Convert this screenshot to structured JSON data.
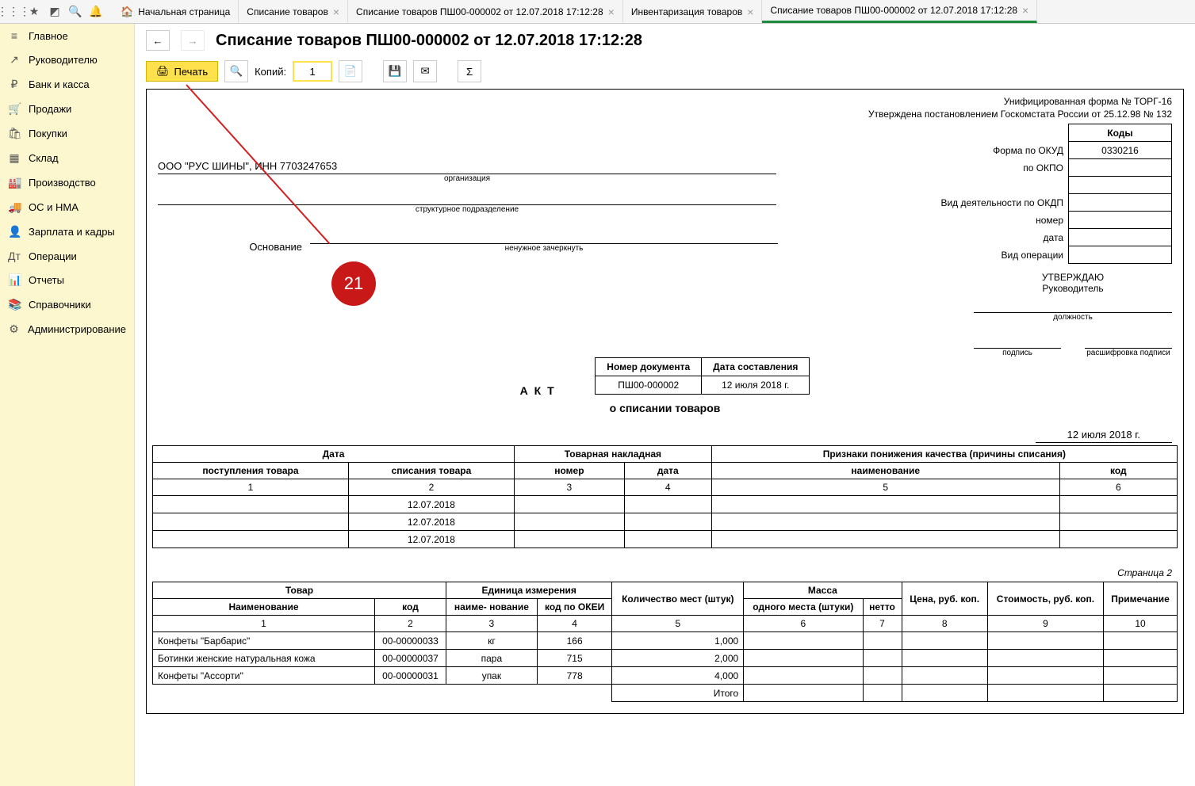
{
  "toolbar": {
    "icons": [
      "apps",
      "star",
      "crop",
      "search",
      "bell"
    ]
  },
  "tabs": [
    {
      "label": "Начальная страница",
      "home": true
    },
    {
      "label": "Списание товаров",
      "close": true
    },
    {
      "label": "Списание товаров ПШ00-000002 от 12.07.2018 17:12:28",
      "close": true
    },
    {
      "label": "Инвентаризация товаров",
      "close": true
    },
    {
      "label": "Списание товаров ПШ00-000002 от 12.07.2018 17:12:28",
      "close": true,
      "active": true
    }
  ],
  "sidebar": [
    {
      "icon": "≡",
      "label": "Главное"
    },
    {
      "icon": "↗",
      "label": "Руководителю"
    },
    {
      "icon": "₽",
      "label": "Банк и касса"
    },
    {
      "icon": "🛒",
      "label": "Продажи"
    },
    {
      "icon": "🛍",
      "label": "Покупки"
    },
    {
      "icon": "▦",
      "label": "Склад"
    },
    {
      "icon": "🏭",
      "label": "Производство"
    },
    {
      "icon": "🚚",
      "label": "ОС и НМА"
    },
    {
      "icon": "👤",
      "label": "Зарплата и кадры"
    },
    {
      "icon": "Дт",
      "label": "Операции"
    },
    {
      "icon": "📊",
      "label": "Отчеты"
    },
    {
      "icon": "📚",
      "label": "Справочники"
    },
    {
      "icon": "⚙",
      "label": "Администрирование"
    }
  ],
  "page_title": "Списание товаров ПШ00-000002 от 12.07.2018 17:12:28",
  "print_bar": {
    "print": "Печать",
    "copies_label": "Копий:",
    "copies_value": "1"
  },
  "callout": {
    "number": "21"
  },
  "form": {
    "top_right1": "Унифицированная форма № ТОРГ-16",
    "top_right2": "Утверждена постановлением Госкомстата России от 25.12.98 № 132",
    "codes_header": "Коды",
    "rows": [
      {
        "label": "Форма по ОКУД",
        "value": "0330216"
      },
      {
        "label": "по ОКПО",
        "value": ""
      },
      {
        "label": "",
        "value": ""
      },
      {
        "label": "Вид деятельности по ОКДП",
        "value": ""
      },
      {
        "label": "номер",
        "value": ""
      },
      {
        "label": "дата",
        "value": ""
      },
      {
        "label": "Вид операции",
        "value": ""
      }
    ],
    "org": "ООО \"РУС ШИНЫ\", ИНН 7703247653",
    "org_cap": "организация",
    "subdiv_cap": "структурное подразделение",
    "basis_label": "Основание",
    "basis_cap": "ненужное зачеркнуть",
    "approve": {
      "l1": "УТВЕРЖДАЮ",
      "l2": "Руководитель",
      "cap_pos": "должность",
      "cap_sign": "подпись",
      "cap_name": "расшифровка подписи"
    },
    "doc_num_header": "Номер документа",
    "doc_date_header": "Дата составления",
    "doc_num": "ПШ00-000002",
    "doc_date": "12 июля 2018 г.",
    "act": "А К Т",
    "act_sub": "о списании товаров",
    "date_right": "12 июля 2018 г."
  },
  "table1": {
    "headers": {
      "date": "Дата",
      "receipt": "поступления товара",
      "writeoff": "списания товара",
      "invoice": "Товарная накладная",
      "num": "номер",
      "dt": "дата",
      "reasons": "Признаки понижения качества (причины списания)",
      "name": "наименование",
      "code": "код"
    },
    "nums": [
      "1",
      "2",
      "3",
      "4",
      "5",
      "6"
    ],
    "rows": [
      {
        "c2": "12.07.2018"
      },
      {
        "c2": "12.07.2018"
      },
      {
        "c2": "12.07.2018"
      }
    ]
  },
  "page2_label": "Страница 2",
  "table2": {
    "headers": {
      "product": "Товар",
      "name": "Наименование",
      "code": "код",
      "unit": "Единица измерения",
      "uname": "наиме-\nнование",
      "ucode": "код по ОКЕИ",
      "qty": "Количество мест (штук)",
      "mass": "Масса",
      "m1": "одного места (штуки)",
      "m2": "нетто",
      "price": "Цена, руб. коп.",
      "cost": "Стоимость, руб. коп.",
      "note": "Примечание"
    },
    "nums": [
      "1",
      "2",
      "3",
      "4",
      "5",
      "6",
      "7",
      "8",
      "9",
      "10"
    ],
    "rows": [
      {
        "name": "Конфеты \"Барбарис\"",
        "code": "00-00000033",
        "unit": "кг",
        "okei": "166",
        "qty": "1,000"
      },
      {
        "name": "Ботинки женские натуральная кожа",
        "code": "00-00000037",
        "unit": "пара",
        "okei": "715",
        "qty": "2,000"
      },
      {
        "name": "Конфеты \"Ассорти\"",
        "code": "00-00000031",
        "unit": "упак",
        "okei": "778",
        "qty": "4,000"
      }
    ],
    "total": "Итого"
  }
}
